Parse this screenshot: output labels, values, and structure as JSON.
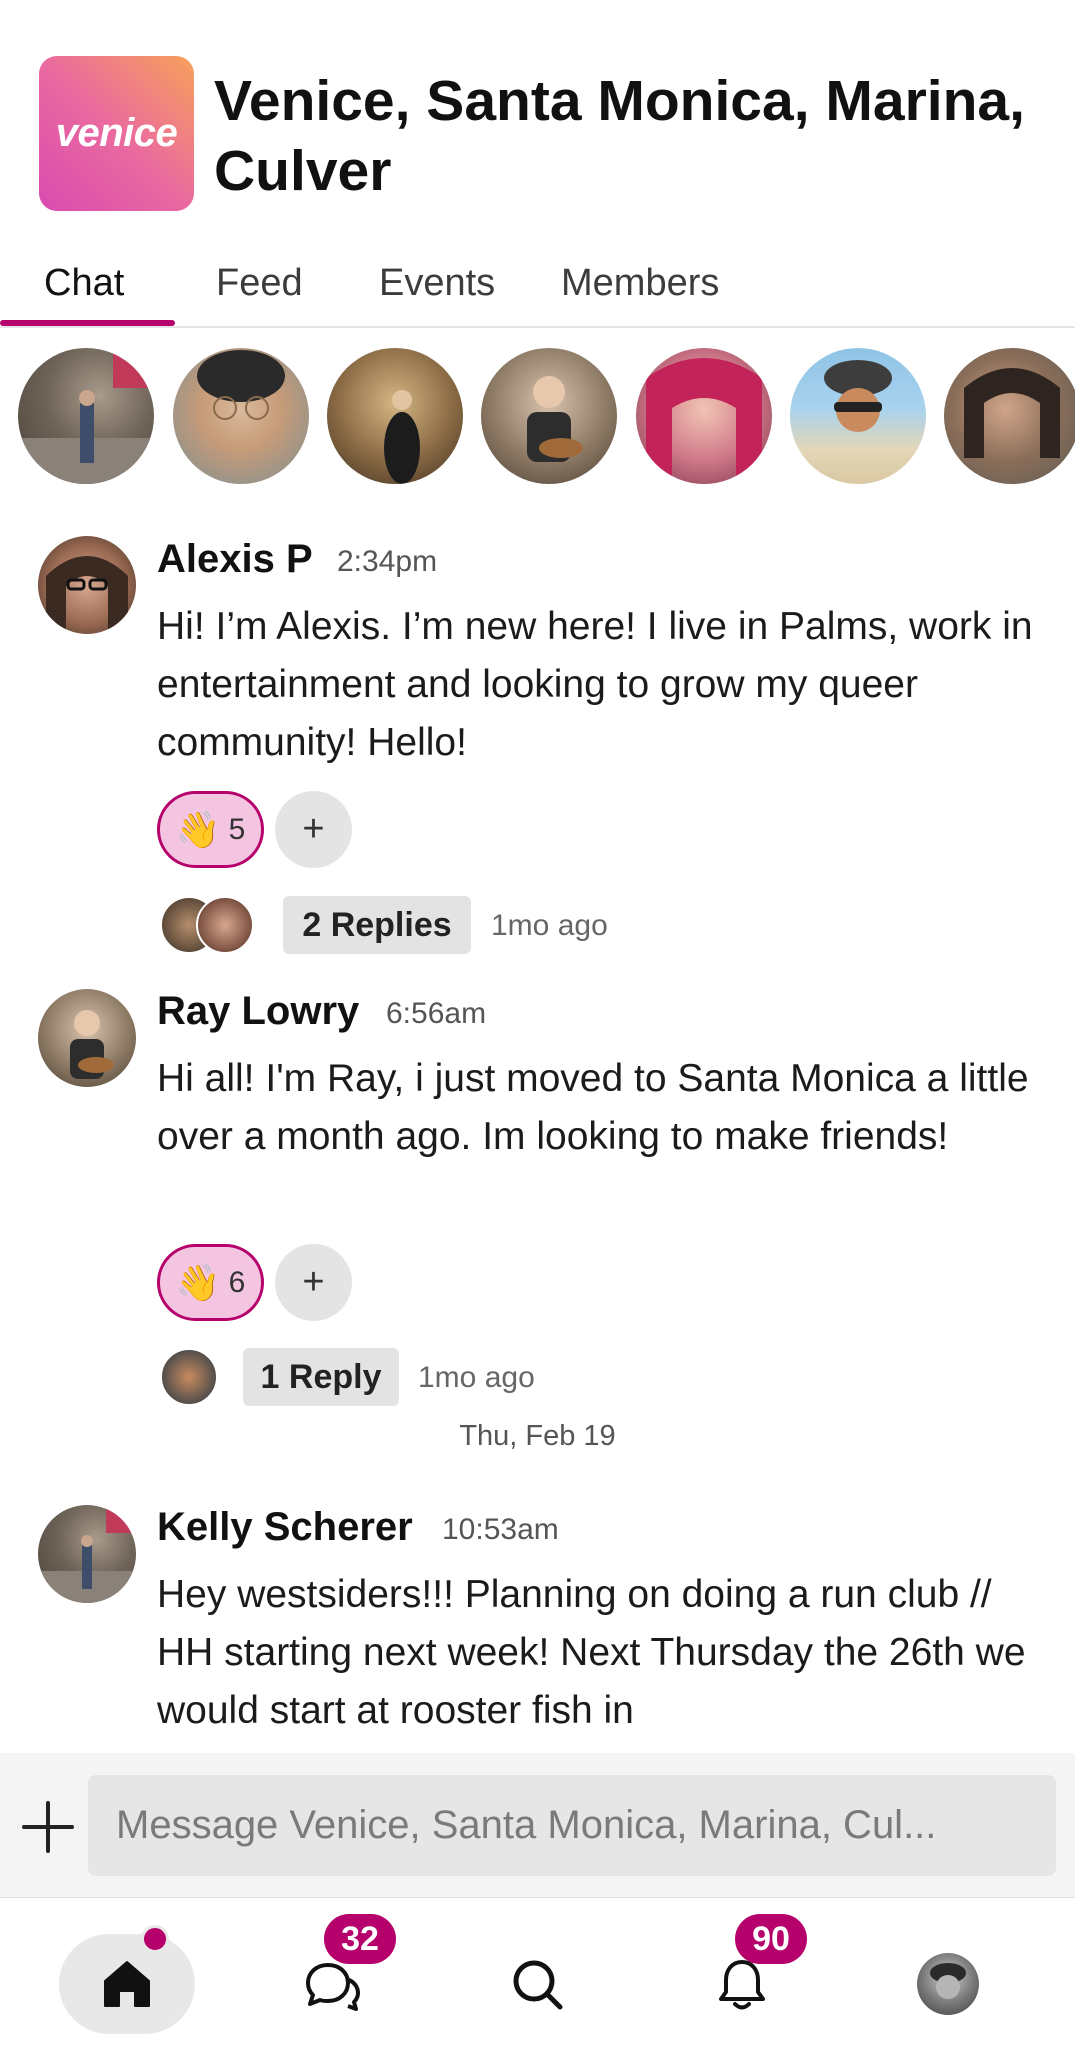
{
  "group": {
    "logo_text": "venice",
    "title": "Venice, Santa Monica, Marina, Culver"
  },
  "tabs": [
    {
      "label": "Chat",
      "active": true
    },
    {
      "label": "Feed",
      "active": false
    },
    {
      "label": "Events",
      "active": false
    },
    {
      "label": "Members",
      "active": false
    }
  ],
  "stories": [
    {
      "name": "member-1"
    },
    {
      "name": "member-2"
    },
    {
      "name": "member-3"
    },
    {
      "name": "member-4"
    },
    {
      "name": "member-5"
    },
    {
      "name": "member-6"
    },
    {
      "name": "member-7"
    }
  ],
  "messages": [
    {
      "author": "Alexis P",
      "time": "2:34pm",
      "text": "Hi! I’m Alexis. I’m new here! I live in Palms, work in entertainment and looking to grow my queer community! Hello!",
      "reaction": {
        "emoji": "👋",
        "count": "5"
      },
      "add_reaction_label": "+",
      "replies": {
        "label": "2 Replies",
        "ago": "1mo ago"
      }
    },
    {
      "author": "Ray Lowry",
      "time": "6:56am",
      "text": "Hi all! I'm Ray, i just moved to Santa Monica a little over a month ago. Im looking to make friends!",
      "reaction": {
        "emoji": "👋",
        "count": "6"
      },
      "add_reaction_label": "+",
      "replies": {
        "label": "1 Reply",
        "ago": "1mo ago"
      }
    },
    {
      "author": "Kelly Scherer",
      "time": "10:53am",
      "text": "Hey westsiders!!! Planning on doing a run club // HH starting next week! Next Thursday the 26th we would start at rooster fish in"
    }
  ],
  "date_separator": "Thu, Feb 19",
  "composer": {
    "placeholder": "Message Venice, Santa Monica, Marina, Cul..."
  },
  "bottom_nav": {
    "home": {
      "label": "Home",
      "has_dot": true
    },
    "chats": {
      "label": "Chats",
      "badge": "32"
    },
    "search": {
      "label": "Search"
    },
    "notifications": {
      "label": "Notifications",
      "badge": "90"
    },
    "profile": {
      "label": "Profile"
    }
  },
  "colors": {
    "accent": "#b6006b",
    "reaction_bg": "#f3c5e0"
  }
}
